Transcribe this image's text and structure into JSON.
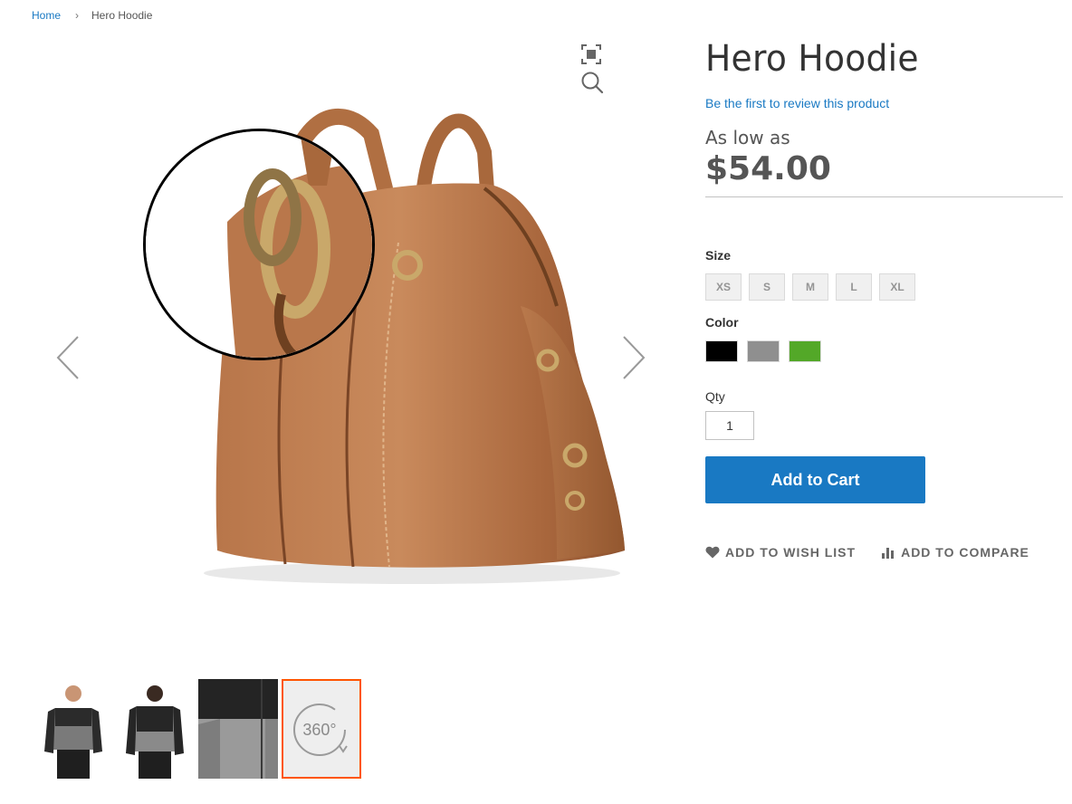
{
  "breadcrumb": {
    "home": "Home",
    "separator": "›",
    "current": "Hero Hoodie"
  },
  "product": {
    "title": "Hero Hoodie",
    "review_link": "Be the first to review this product",
    "price_label": "As low as",
    "price": "$54.00"
  },
  "options": {
    "size_label": "Size",
    "sizes": [
      "XS",
      "S",
      "M",
      "L",
      "XL"
    ],
    "color_label": "Color",
    "colors": [
      "#000000",
      "#8f8f8f",
      "#53a828"
    ]
  },
  "qty": {
    "label": "Qty",
    "value": "1"
  },
  "cart": {
    "add_label": "Add to Cart"
  },
  "actions": {
    "wishlist": "ADD TO WISH LIST",
    "compare": "ADD TO COMPARE"
  },
  "gallery": {
    "thumb_360_label": "360°",
    "accent": "#ff5501"
  },
  "colors": {
    "link": "#1979c3",
    "primary_button": "#1979c3"
  }
}
